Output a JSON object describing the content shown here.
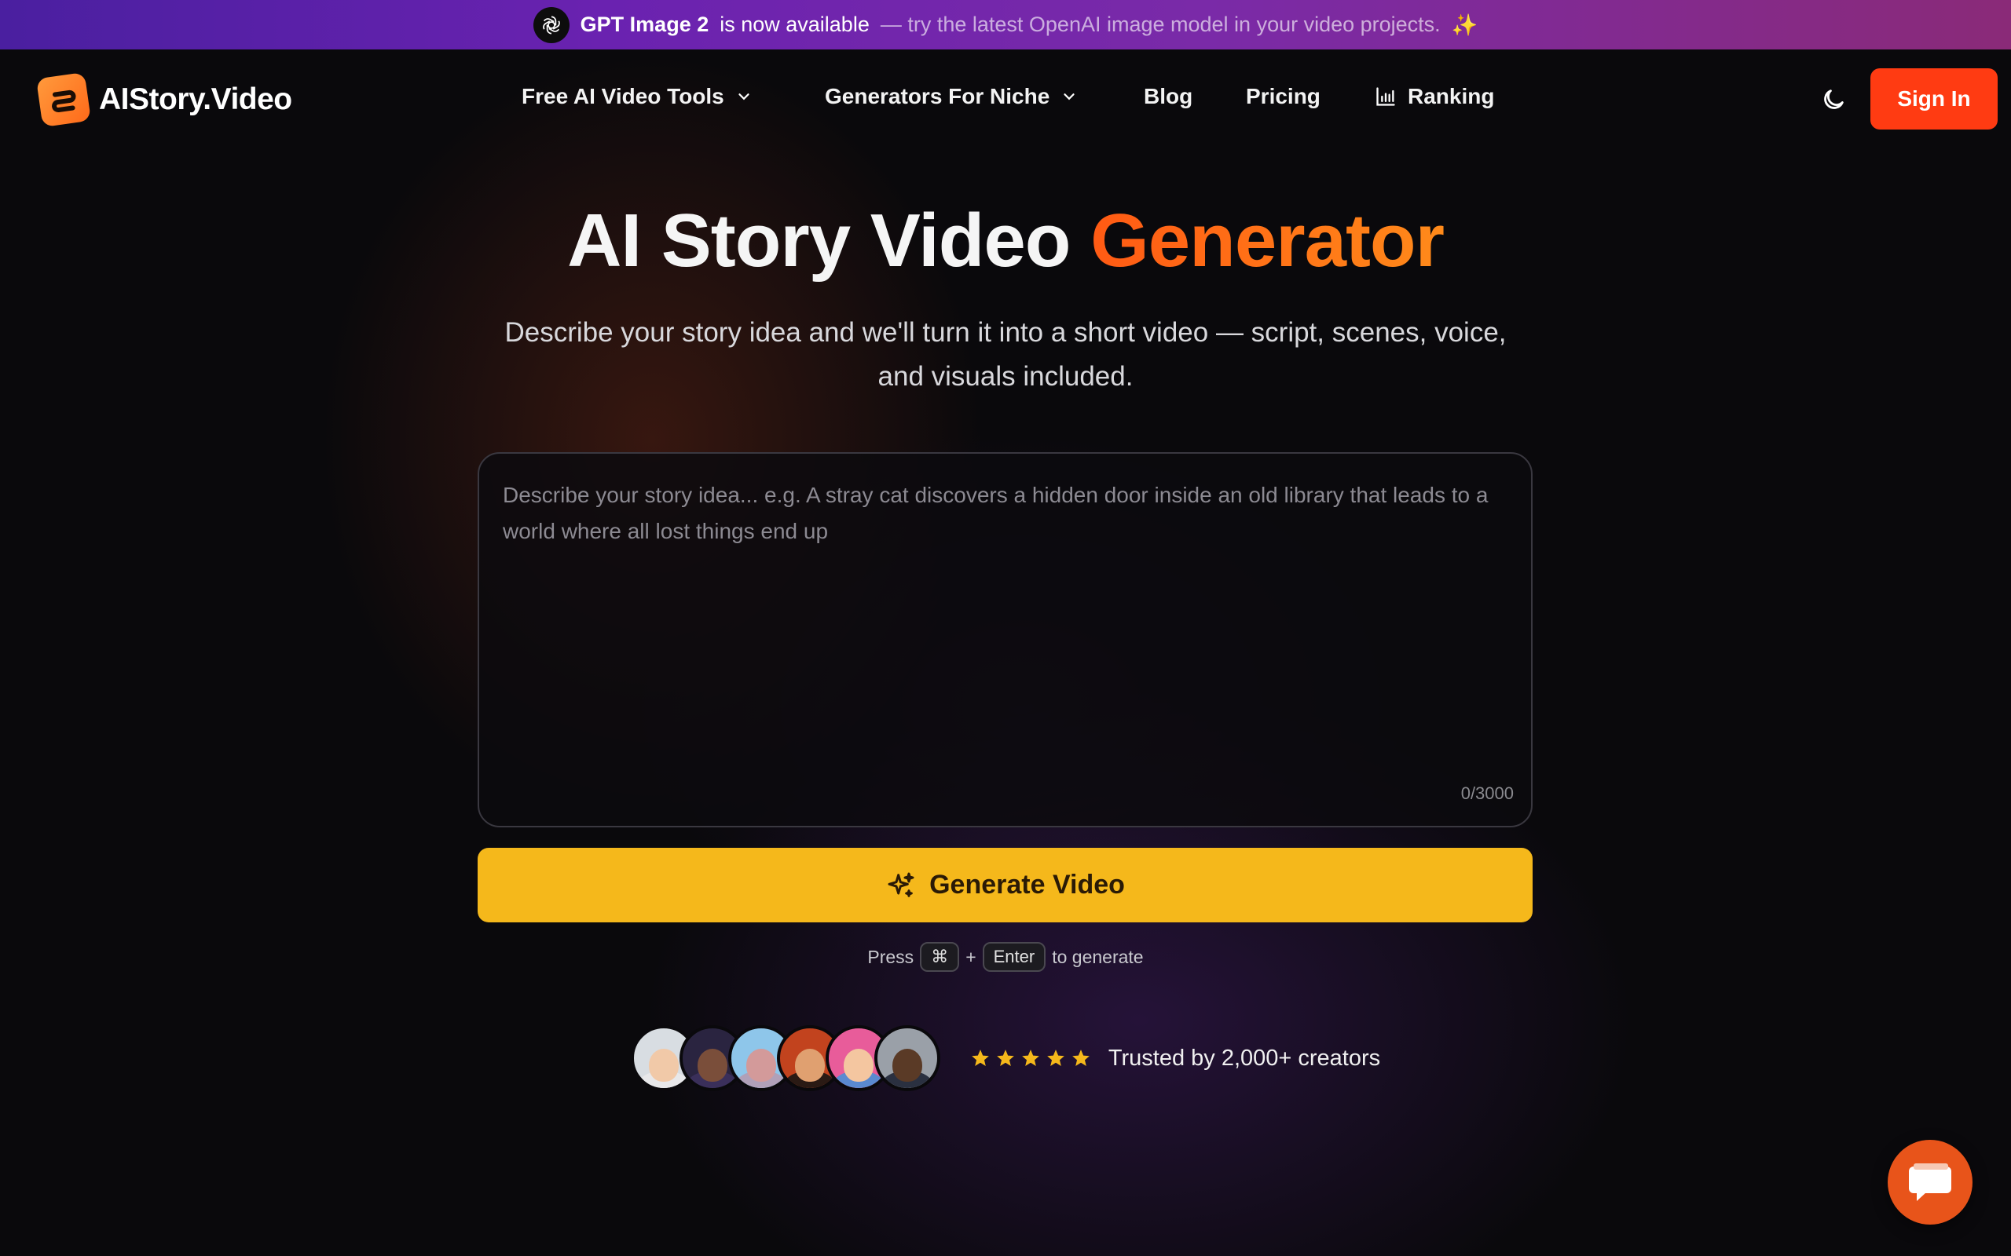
{
  "announcement": {
    "highlight": "GPT Image 2",
    "text": "is now available",
    "detail": "— try the latest OpenAI image model in your video projects.",
    "emoji": "✨",
    "icon": "openai-icon"
  },
  "header": {
    "logo_text": "AIStory.Video",
    "nav": [
      {
        "label": "Free AI Video Tools",
        "has_dropdown": true
      },
      {
        "label": "Generators For Niche",
        "has_dropdown": true
      },
      {
        "label": "Blog",
        "has_dropdown": false
      },
      {
        "label": "Pricing",
        "has_dropdown": false
      },
      {
        "label": "Ranking",
        "icon": "bar-chart-icon"
      }
    ],
    "theme_toggle_icon": "moon-icon",
    "sign_in_label": "Sign In"
  },
  "hero": {
    "title_main": "AI Story Video",
    "title_accent": "Generator",
    "subtitle_line1": "Describe your story idea and we'll turn it into a short video — script, scenes, voice,",
    "subtitle_line2": "and visuals included."
  },
  "story_input": {
    "value": "",
    "placeholder": "Describe your story idea... e.g. A stray cat discovers a hidden door inside an old library that leads to a world where all lost things end up",
    "char_count": "0/3000"
  },
  "generate": {
    "label": "Generate Video",
    "icon": "sparkles-icon"
  },
  "shortcut": {
    "prefix": "Press",
    "key1": "⌘",
    "plus": "+",
    "key2": "Enter",
    "suffix": "to generate"
  },
  "trust": {
    "rating_stars": 5,
    "text": "Trusted by 2,000+ creators"
  },
  "colors": {
    "accent_orange": "#ff5a14",
    "sign_in_bg": "#ff3b12",
    "generate_bg": "#f5b81b",
    "star": "#f5b81b",
    "chat_bg": "#e8541a"
  },
  "chat": {
    "icon": "chat-bubble-icon"
  }
}
